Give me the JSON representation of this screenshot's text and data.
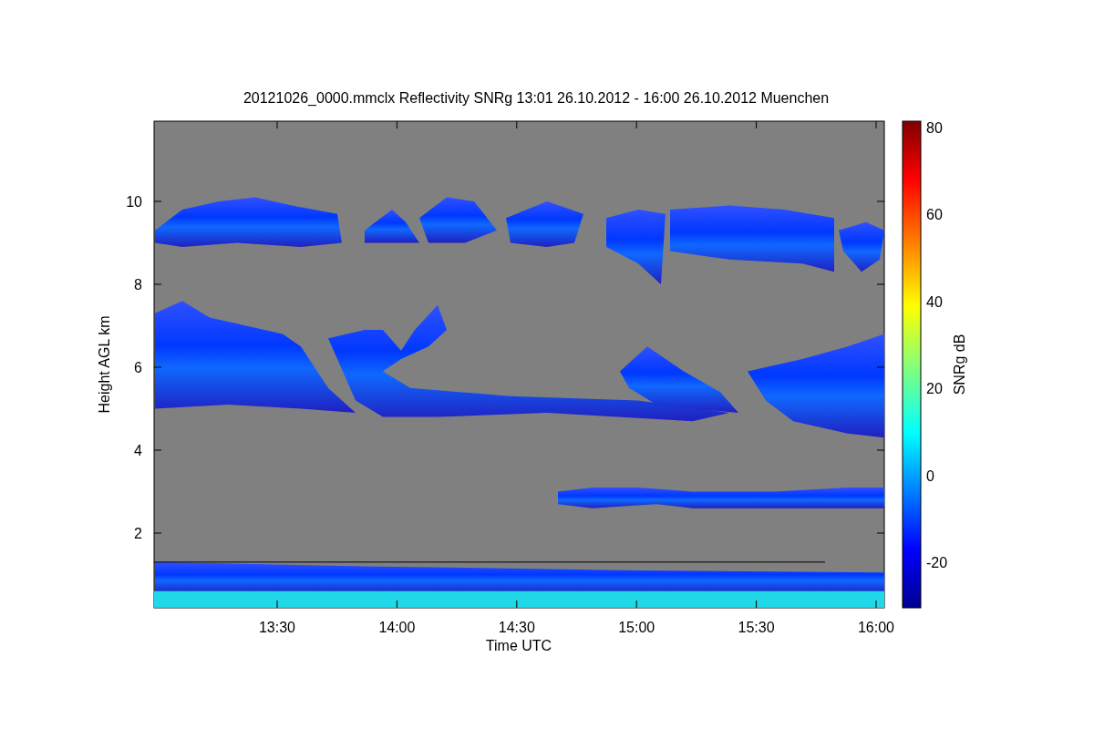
{
  "title": "20121026_0000.mmclx Reflectivity SNRg   13:01 26.10.2012 - 16:00 26.10.2012 Muenchen",
  "x_axis": {
    "label": "Time UTC",
    "ticks": [
      "13:30",
      "14:00",
      "14:30",
      "15:00",
      "15:30",
      "16:00"
    ]
  },
  "y_axis": {
    "label": "Height AGL km",
    "ticks": [
      "10",
      "8",
      "6",
      "4",
      "2"
    ]
  },
  "colorbar": {
    "label": "SNRg dB",
    "ticks": [
      "80",
      "60",
      "40",
      "20",
      "0",
      "-20"
    ]
  }
}
